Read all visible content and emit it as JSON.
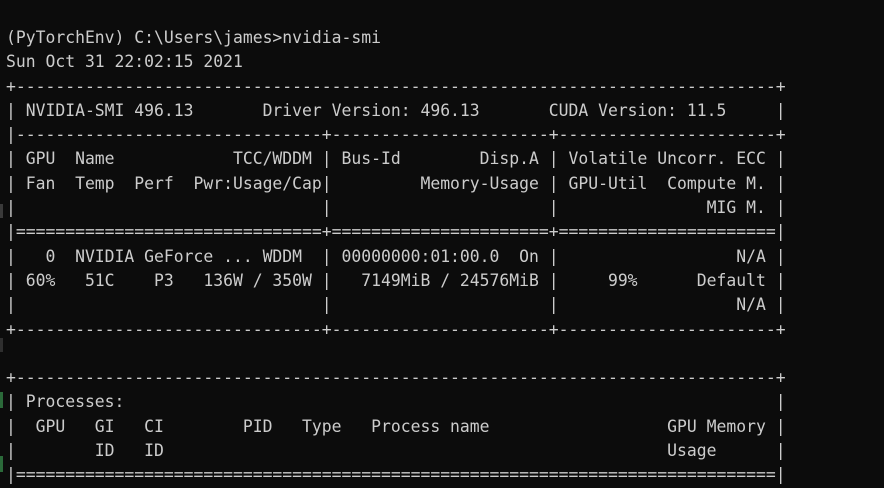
{
  "terminal": {
    "background": "#0c0c0c",
    "foreground": "#cccccc",
    "lines": [
      "(PyTorchEnv) C:\\Users\\james>nvidia-smi",
      "Sun Oct 31 22:02:15 2021",
      "+-----------------------------------------------------------------------------+",
      "| NVIDIA-SMI 496.13       Driver Version: 496.13       CUDA Version: 11.5     |",
      "|-------------------------------+----------------------+----------------------+",
      "| GPU  Name            TCC/WDDM | Bus-Id        Disp.A | Volatile Uncorr. ECC |",
      "| Fan  Temp  Perf  Pwr:Usage/Cap|         Memory-Usage | GPU-Util  Compute M. |",
      "|                               |                      |               MIG M. |",
      "|===============================+======================+======================|",
      "|   0  NVIDIA GeForce ... WDDM  | 00000000:01:00.0  On |                  N/A |",
      "| 60%   51C    P3   136W / 350W |   7149MiB / 24576MiB |     99%      Default |",
      "|                               |                      |                  N/A |",
      "+-------------------------------+----------------------+----------------------+",
      "",
      "+-----------------------------------------------------------------------------+",
      "| Processes:                                                                  |",
      "|  GPU   GI   CI        PID   Type   Process name                  GPU Memory |",
      "|        ID   ID                                                   Usage      |",
      "|=============================================================================|"
    ]
  }
}
